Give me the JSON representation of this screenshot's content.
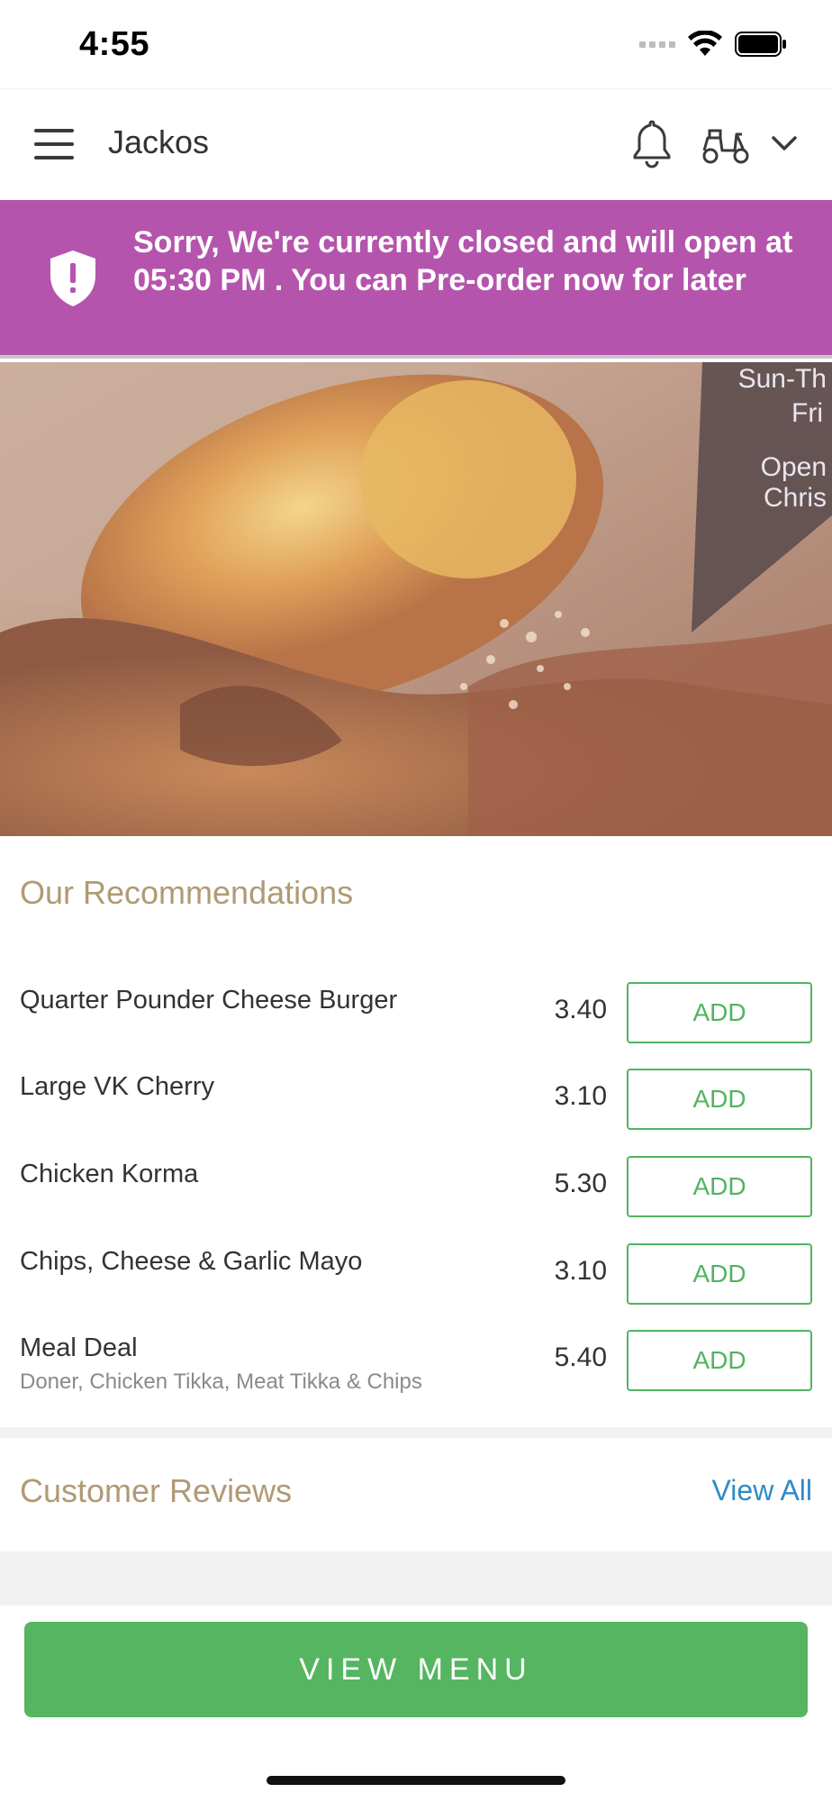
{
  "status_bar": {
    "time": "4:55"
  },
  "header": {
    "title": "Jackos",
    "icons": [
      "menu-icon",
      "bell-icon",
      "scooter-icon",
      "chevron-down-icon"
    ]
  },
  "banner": {
    "text": "Sorry, We're currently closed and will open at 05:30 PM . You can Pre-order now for later",
    "icon": "shield-alert-icon",
    "color": "#b554ad"
  },
  "hero": {
    "sign_lines": [
      "Sun-Th",
      "Fri",
      "Open",
      "Chris"
    ]
  },
  "recommendations": {
    "title": "Our Recommendations",
    "add_label": "ADD",
    "items": [
      {
        "name": "Quarter Pounder Cheese Burger",
        "description": "",
        "price": "3.40"
      },
      {
        "name": "Large VK Cherry",
        "description": "",
        "price": "3.10"
      },
      {
        "name": "Chicken Korma",
        "description": "",
        "price": "5.30"
      },
      {
        "name": "Chips, Cheese & Garlic Mayo",
        "description": "",
        "price": "3.10"
      },
      {
        "name": "Meal Deal",
        "description": "Doner, Chicken Tikka, Meat Tikka & Chips",
        "price": "5.40"
      }
    ]
  },
  "reviews": {
    "title": "Customer Reviews",
    "view_all": "View All"
  },
  "footer": {
    "view_menu": "VIEW MENU",
    "accent_color": "#55b560"
  }
}
